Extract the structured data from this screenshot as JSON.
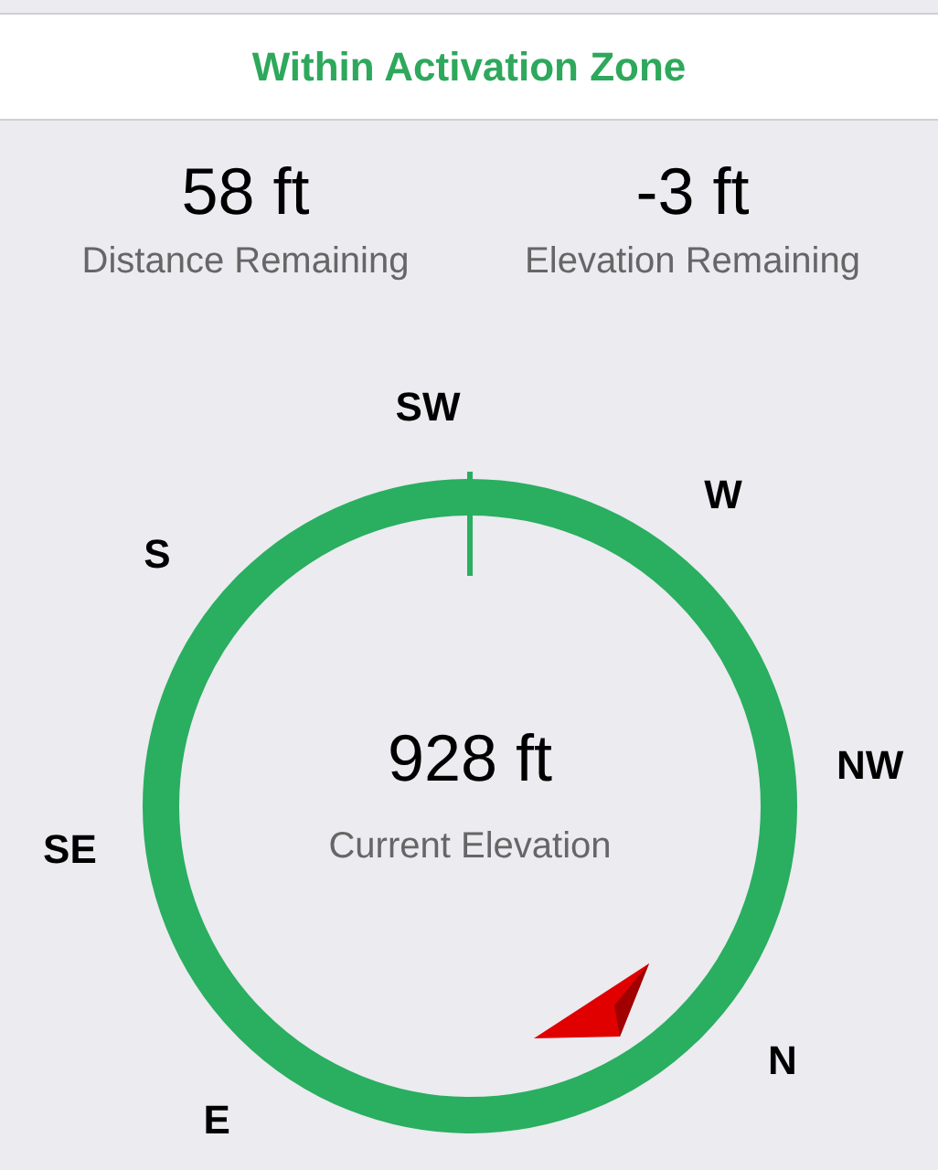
{
  "status_banner": {
    "text": "Within Activation Zone"
  },
  "stats": [
    {
      "value": "58 ft",
      "label": "Distance Remaining"
    },
    {
      "value": "-3 ft",
      "label": "Elevation Remaining"
    }
  ],
  "compass": {
    "center_value": "928 ft",
    "center_label": "Current Elevation",
    "directions": [
      {
        "label": "SW"
      },
      {
        "label": "W"
      },
      {
        "label": "NW"
      },
      {
        "label": "N"
      },
      {
        "label": "E"
      },
      {
        "label": "SE"
      },
      {
        "label": "S"
      }
    ]
  }
}
